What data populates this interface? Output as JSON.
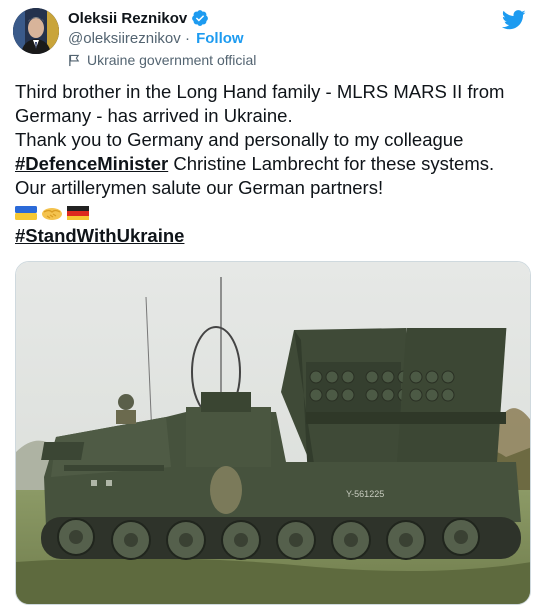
{
  "author": {
    "name": "Oleksii Reznikov",
    "handle": "@oleksiireznikov",
    "separator": "·",
    "follow_label": "Follow",
    "label": "Ukraine government official",
    "verified_icon": "verified-badge-icon",
    "label_icon": "flag-icon"
  },
  "platform_icon": "twitter-bird-icon",
  "tweet": {
    "line1": "Third brother in the Long Hand family - MLRS MARS II from Germany - has arrived in Ukraine.",
    "line2_pre": "Thank you to Germany and personally to my colleague ",
    "hashtag1": "#DefenceMinister",
    "line2_post": " Christine Lambrecht for these systems.",
    "line3": "Our artillerymen salute our German partners!",
    "emojis": [
      "ukraine-flag",
      "handshake",
      "germany-flag"
    ],
    "hashtag2": "#StandWithUkraine"
  },
  "media": {
    "vehicle_marking": "Y-561225"
  },
  "colors": {
    "accent": "#1d9bf0",
    "text": "#0f1419",
    "secondary": "#536471",
    "border": "#cfd9de"
  }
}
